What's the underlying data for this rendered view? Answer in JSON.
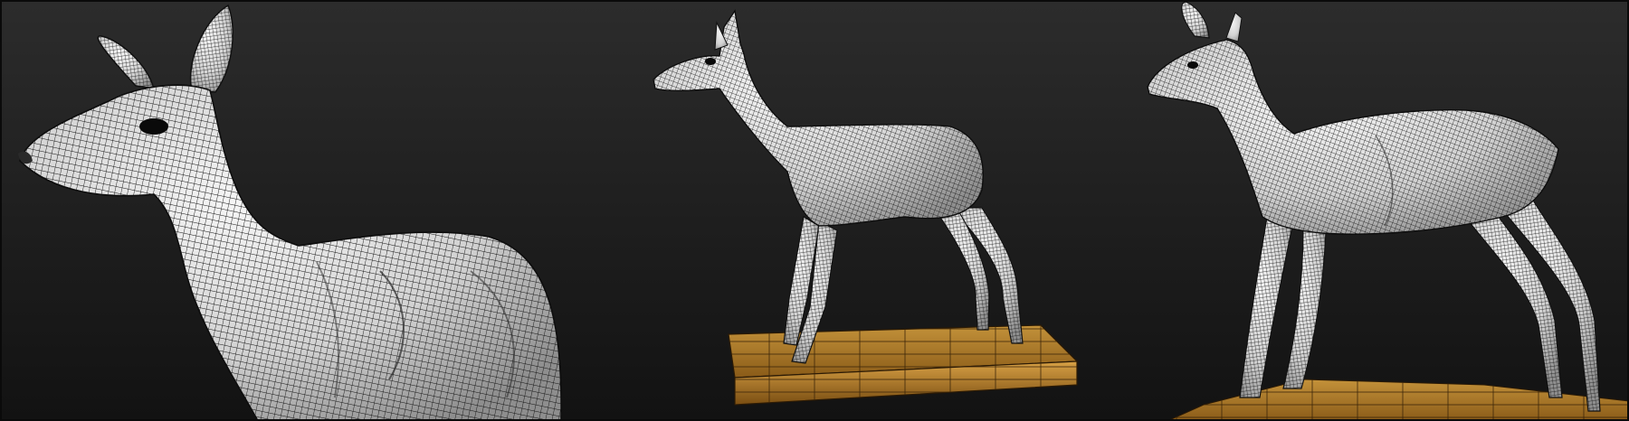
{
  "scene": {
    "background_top": "#2c2c2c",
    "background_bottom": "#121212",
    "wire_color": "#141414",
    "mesh_fill_light": "#f4f4f4",
    "mesh_fill_shade": "#b9b9b9",
    "base_color": "#b8862c",
    "base_color_dark": "#6f4a12"
  },
  "views": [
    {
      "name": "close-up-head-neck-view"
    },
    {
      "name": "side-full-body-on-base-view"
    },
    {
      "name": "three-quarter-full-body-view"
    }
  ]
}
